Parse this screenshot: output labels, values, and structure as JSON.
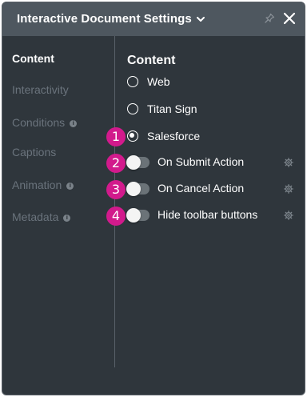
{
  "header": {
    "title": "Interactive Document Settings"
  },
  "sidebar": {
    "items": [
      {
        "label": "Content"
      },
      {
        "label": "Interactivity"
      },
      {
        "label": "Conditions"
      },
      {
        "label": "Captions"
      },
      {
        "label": "Animation"
      },
      {
        "label": "Metadata"
      }
    ]
  },
  "main": {
    "section_title": "Content",
    "radio_options": [
      {
        "label": "Web",
        "selected": false
      },
      {
        "label": "Titan Sign",
        "selected": false
      },
      {
        "label": "Salesforce",
        "selected": true
      }
    ],
    "toggles": [
      {
        "label": "On Submit Action",
        "on": false
      },
      {
        "label": "On Cancel Action",
        "on": false
      },
      {
        "label": "Hide toolbar buttons",
        "on": false
      }
    ]
  },
  "callouts": [
    "1",
    "2",
    "3",
    "4"
  ],
  "colors": {
    "panel": "#2f363c",
    "titlebar": "#4e575f",
    "badge": "#d21a8c"
  },
  "icons": [
    "chevron-down-icon",
    "pin-icon",
    "close-icon",
    "info-icon",
    "gear-icon"
  ]
}
